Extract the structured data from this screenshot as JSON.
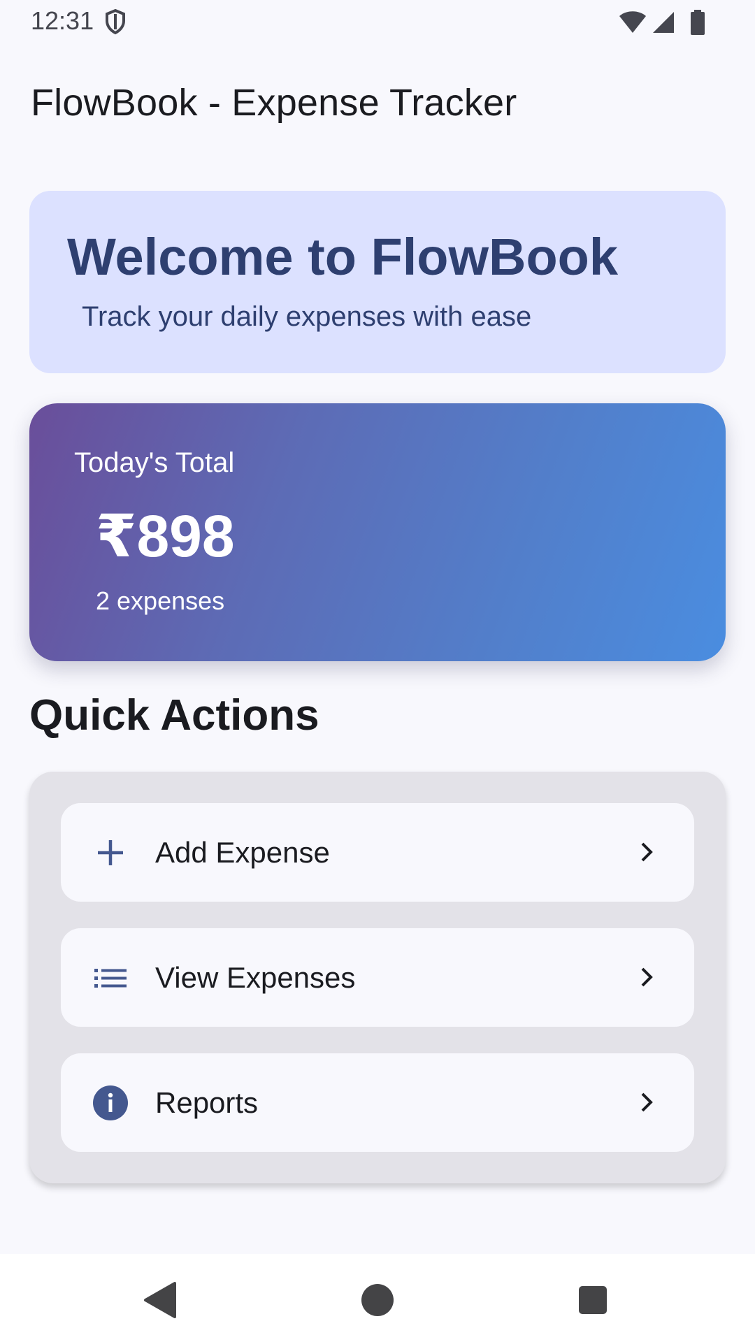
{
  "status_bar": {
    "time": "12:31",
    "icons": [
      "shield-icon",
      "wifi-icon",
      "cell-signal-icon",
      "battery-icon"
    ]
  },
  "app_bar": {
    "title": "FlowBook - Expense Tracker"
  },
  "welcome": {
    "title": "Welcome to FlowBook",
    "subtitle": "Track your daily expenses with ease"
  },
  "today": {
    "label": "Today's Total",
    "amount": "₹898",
    "count_text": "2 expenses"
  },
  "quick_actions": {
    "heading": "Quick Actions",
    "items": [
      {
        "label": "Add Expense",
        "icon": "plus-icon"
      },
      {
        "label": "View Expenses",
        "icon": "list-icon"
      },
      {
        "label": "Reports",
        "icon": "info-icon"
      }
    ]
  },
  "nav": {
    "buttons": [
      "back-icon",
      "home-icon",
      "recents-icon"
    ]
  },
  "colors": {
    "background": "#F8F8FD",
    "welcome_card": "#DCE1FF",
    "welcome_text": "#2E3F70",
    "gradient_start": "#6A4E9A",
    "gradient_end": "#4A8DE0",
    "panel": "#E3E2E8",
    "icon_accent": "#44588F"
  }
}
